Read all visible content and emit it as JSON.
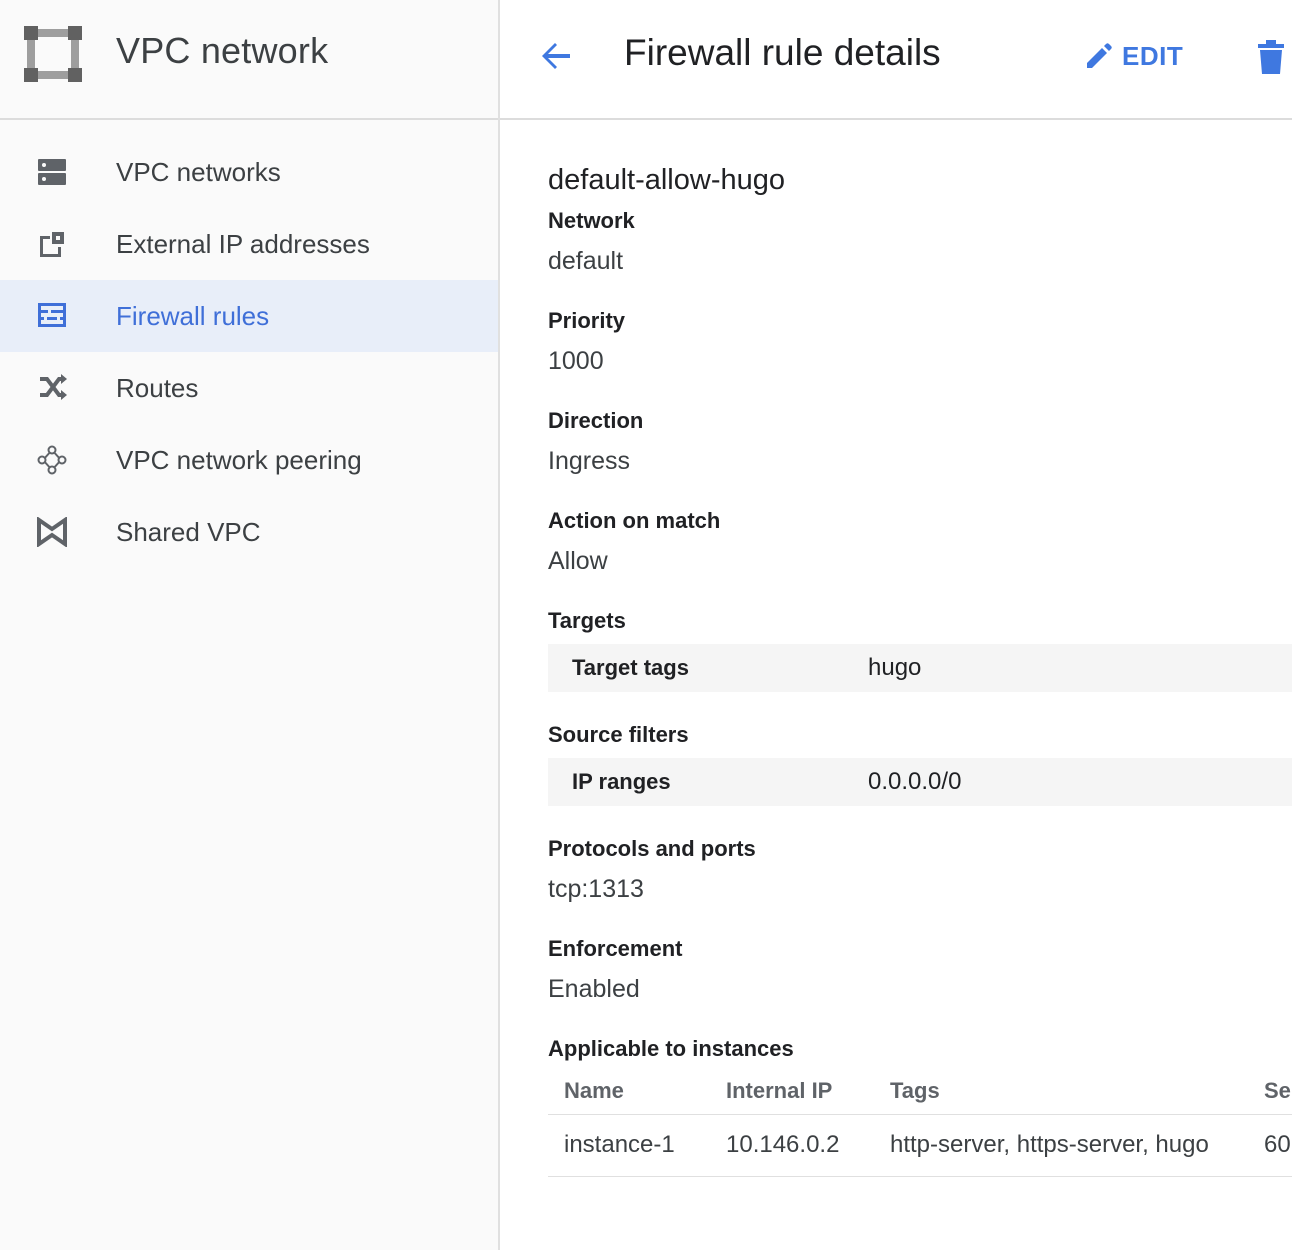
{
  "sidebar": {
    "title": "VPC network",
    "items": [
      {
        "label": "VPC networks",
        "icon": "vpc-networks-icon",
        "active": false
      },
      {
        "label": "External IP addresses",
        "icon": "external-ip-icon",
        "active": false
      },
      {
        "label": "Firewall rules",
        "icon": "firewall-icon",
        "active": true
      },
      {
        "label": "Routes",
        "icon": "routes-icon",
        "active": false
      },
      {
        "label": "VPC network peering",
        "icon": "peering-icon",
        "active": false
      },
      {
        "label": "Shared VPC",
        "icon": "shared-vpc-icon",
        "active": false
      }
    ]
  },
  "header": {
    "title": "Firewall rule details",
    "edit_label": "EDIT"
  },
  "rule": {
    "name": "default-allow-hugo",
    "network": {
      "label": "Network",
      "value": "default"
    },
    "priority": {
      "label": "Priority",
      "value": "1000"
    },
    "direction": {
      "label": "Direction",
      "value": "Ingress"
    },
    "action": {
      "label": "Action on match",
      "value": "Allow"
    },
    "targets": {
      "label": "Targets",
      "key": "Target tags",
      "value": "hugo"
    },
    "source": {
      "label": "Source filters",
      "key": "IP ranges",
      "value": "0.0.0.0/0"
    },
    "protocols": {
      "label": "Protocols and ports",
      "value": "tcp:1313"
    },
    "enforcement": {
      "label": "Enforcement",
      "value": "Enabled"
    }
  },
  "instances": {
    "label": "Applicable to instances",
    "columns": [
      "Name",
      "Internal IP",
      "Tags",
      "Se"
    ],
    "rows": [
      {
        "name": "instance-1",
        "ip": "10.146.0.2",
        "tags": "http-server, https-server, hugo",
        "extra": "60"
      }
    ]
  },
  "colors": {
    "accent": "#3f78e0",
    "active_bg": "#e8eef9",
    "active_text": "#3f6fd8",
    "icon_grey": "#5f6368"
  }
}
